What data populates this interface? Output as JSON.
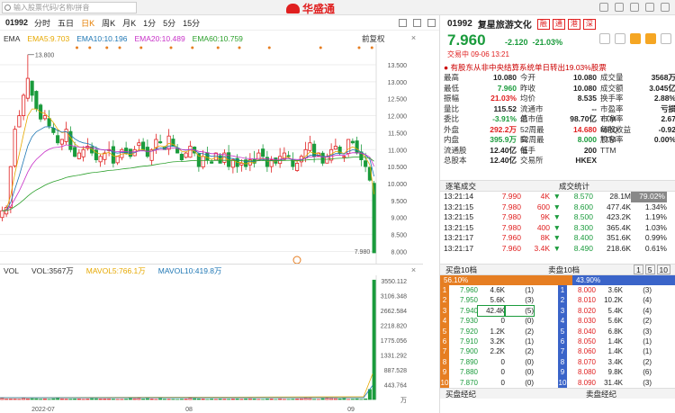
{
  "app": {
    "logo_text": "华盛通",
    "search_placeholder": "输入股票代码/名称/拼音"
  },
  "tabs": {
    "code": "01992",
    "items": [
      "分时",
      "五日",
      "日K",
      "周K",
      "月K",
      "1分",
      "5分",
      "15分"
    ],
    "active": "日K"
  },
  "chart": {
    "ma_labels": [
      "EMA",
      "EMA5:9.703",
      "EMA10:10.196",
      "EMA20:10.489",
      "EMA60:10.759"
    ],
    "ma_colors": [
      "#333333",
      "#e6a800",
      "#1f77b4",
      "#c832c8",
      "#2ca02c"
    ],
    "adjust": "前复权",
    "high_label": "13.800",
    "low_label": "7.980",
    "price_ticks": [
      "13.500",
      "13.000",
      "12.500",
      "12.000",
      "11.500",
      "11.000",
      "10.500",
      "10.000",
      "9.500",
      "9.000",
      "8.500",
      "8.000"
    ],
    "vol_labels": [
      "VOL",
      "VOL:3567万",
      "MAVOL5:766.1万",
      "MAVOL10:419.8万"
    ],
    "vol_colors": [
      "#333333",
      "#333333",
      "#e6a800",
      "#1f77b4"
    ],
    "vol_ticks": [
      "3550.112",
      "3106.348",
      "2662.584",
      "2218.820",
      "1775.056",
      "1331.292",
      "887.528",
      "443.764",
      "万"
    ],
    "date_ticks": [
      "2022-07",
      "08",
      "09"
    ]
  },
  "quote": {
    "code": "01992",
    "name": "复星旅游文化",
    "badges": [
      "融",
      "通",
      "港",
      "深"
    ],
    "price": "7.960",
    "change": "-2.120",
    "change_pct": "-21.03%",
    "time": "交易中 09-06 13:21",
    "news": "有股东从非中央结算系统单日转出19.03%股票",
    "rows": [
      [
        "最高",
        "10.080",
        "今开",
        "10.080",
        "成交量",
        "3568万"
      ],
      [
        "最低",
        "7.960",
        "昨收",
        "10.080",
        "成交额",
        "3.045亿"
      ],
      [
        "振幅",
        "21.03%",
        "均价",
        "8.535",
        "换手率",
        "2.88%"
      ],
      [
        "量比",
        "115.52",
        "流通市值",
        "--",
        "市盈率TTM",
        "亏损"
      ],
      [
        "委比",
        "-3.91%",
        "总市值",
        "98.70亿",
        "市净率MRQ",
        "2.67"
      ],
      [
        "外盘",
        "292.2万",
        "52周最高",
        "14.680",
        "每股收益TTM",
        "-0.92"
      ],
      [
        "内盘",
        "395.9万",
        "52周最低",
        "8.000",
        "股息率TTM",
        "0.00%"
      ],
      [
        "流通股",
        "12.40亿",
        "每手",
        "200",
        "",
        ""
      ],
      [
        "总股本",
        "12.40亿",
        "交易所",
        "HKEX",
        "",
        ""
      ]
    ]
  },
  "ticks": {
    "title_left": "逐笔成交",
    "title_right": "成交统计",
    "rows": [
      [
        "13:21:14",
        "7.990",
        "4K",
        "▼",
        "8.570",
        "28.1M",
        "79.02%"
      ],
      [
        "13:21:15",
        "7.980",
        "600",
        "▼",
        "8.600",
        "477.4K",
        "1.34%"
      ],
      [
        "13:21:15",
        "7.980",
        "9K",
        "▼",
        "8.500",
        "423.2K",
        "1.19%"
      ],
      [
        "13:21:15",
        "7.980",
        "400",
        "▼",
        "8.300",
        "365.4K",
        "1.03%"
      ],
      [
        "13:21:17",
        "7.960",
        "8K",
        "▼",
        "8.400",
        "351.6K",
        "0.99%"
      ],
      [
        "13:21:17",
        "7.960",
        "3.4K",
        "▼",
        "8.490",
        "218.6K",
        "0.61%"
      ]
    ]
  },
  "orderbook": {
    "buy_title": "买盘10档",
    "sell_title": "卖盘10档",
    "levels": [
      "1",
      "5",
      "10"
    ],
    "buy_pct": "56.10%",
    "sell_pct": "43.90%",
    "buy": [
      [
        "1",
        "7.960",
        "4.6K",
        "(1)"
      ],
      [
        "2",
        "7.950",
        "5.6K",
        "(3)"
      ],
      [
        "3",
        "7.940",
        "42.4K",
        "(5)"
      ],
      [
        "4",
        "7.930",
        "0",
        "(0)"
      ],
      [
        "5",
        "7.920",
        "1.2K",
        "(2)"
      ],
      [
        "6",
        "7.910",
        "3.2K",
        "(1)"
      ],
      [
        "7",
        "7.900",
        "2.2K",
        "(2)"
      ],
      [
        "8",
        "7.890",
        "0",
        "(0)"
      ],
      [
        "9",
        "7.880",
        "0",
        "(0)"
      ],
      [
        "10",
        "7.870",
        "0",
        "(0)"
      ]
    ],
    "sell": [
      [
        "1",
        "8.000",
        "3.6K",
        "(3)"
      ],
      [
        "2",
        "8.010",
        "10.2K",
        "(4)"
      ],
      [
        "3",
        "8.020",
        "5.4K",
        "(4)"
      ],
      [
        "4",
        "8.030",
        "5.6K",
        "(2)"
      ],
      [
        "5",
        "8.040",
        "6.8K",
        "(3)"
      ],
      [
        "6",
        "8.050",
        "1.4K",
        "(1)"
      ],
      [
        "7",
        "8.060",
        "1.4K",
        "(1)"
      ],
      [
        "8",
        "8.070",
        "3.4K",
        "(2)"
      ],
      [
        "9",
        "8.080",
        "9.8K",
        "(6)"
      ],
      [
        "10",
        "8.090",
        "31.4K",
        "(3)"
      ]
    ],
    "foot_left": "买盘经纪",
    "foot_right": "卖盘经纪"
  }
}
